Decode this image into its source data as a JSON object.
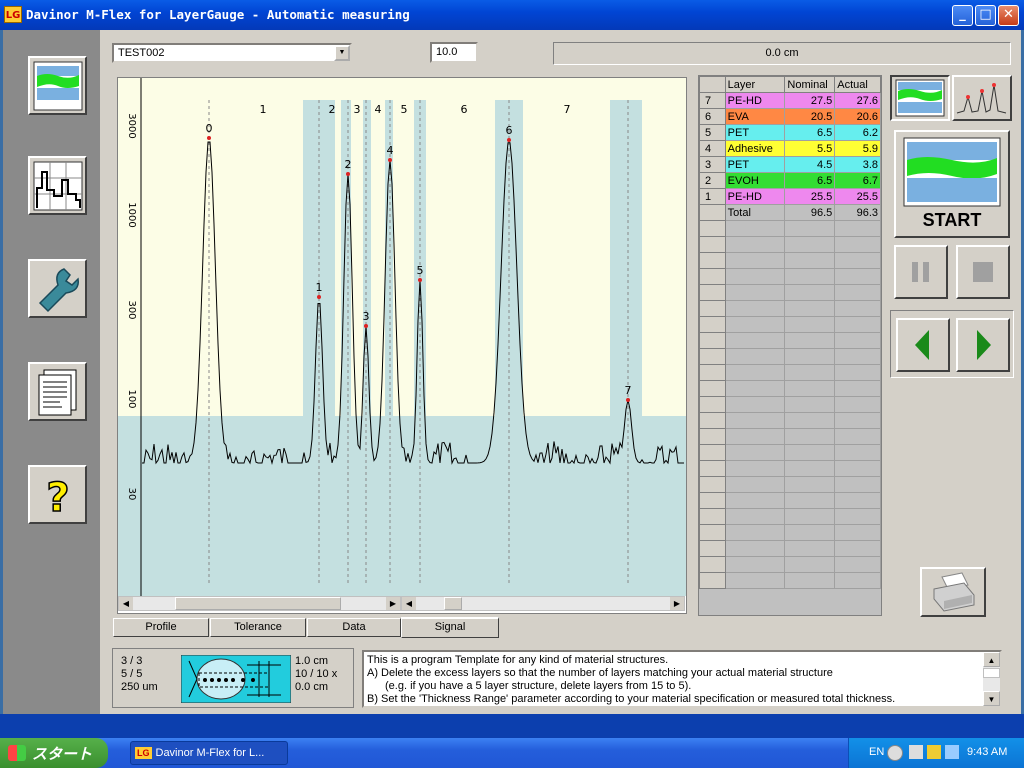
{
  "window": {
    "title": "Davinor M-Flex for LayerGauge - Automatic measuring",
    "logo": "LG"
  },
  "toolbar": {
    "combo_value": "TEST002",
    "range_value": "10.0",
    "position_readout": "0.0 cm"
  },
  "nav": [
    "profile-view-icon",
    "statistics-icon",
    "settings-wrench-icon",
    "report-icon",
    "help-icon"
  ],
  "chart_data": {
    "type": "line",
    "yaxis": {
      "scale": "log",
      "tick_labels": [
        "3000",
        "1000",
        "300",
        "100",
        "30"
      ]
    },
    "layer_labels": [
      "1",
      "2",
      "3",
      "4",
      "5",
      "6",
      "7"
    ],
    "peaks": [
      {
        "label": "0"
      },
      {
        "label": "1"
      },
      {
        "label": "2"
      },
      {
        "label": "3"
      },
      {
        "label": "4"
      },
      {
        "label": "5"
      },
      {
        "label": "6"
      },
      {
        "label": "7"
      }
    ]
  },
  "tabs": [
    "Profile",
    "Tolerance",
    "Data",
    "Signal"
  ],
  "active_tab": "Signal",
  "layer_table": {
    "headers": [
      "Layer",
      "Nominal",
      "Actual"
    ],
    "rows": [
      {
        "index": "7",
        "layer": "PE-HD",
        "nominal": "27.5",
        "actual": "27.6",
        "color": "#ee88ee"
      },
      {
        "index": "6",
        "layer": "EVA",
        "nominal": "20.5",
        "actual": "20.6",
        "color": "#ff8844"
      },
      {
        "index": "5",
        "layer": "PET",
        "nominal": "6.5",
        "actual": "6.2",
        "color": "#66eeee"
      },
      {
        "index": "4",
        "layer": "Adhesive",
        "nominal": "5.5",
        "actual": "5.9",
        "color": "#ffff33"
      },
      {
        "index": "3",
        "layer": "PET",
        "nominal": "4.5",
        "actual": "3.8",
        "color": "#66eeee"
      },
      {
        "index": "2",
        "layer": "EVOH",
        "nominal": "6.5",
        "actual": "6.7",
        "color": "#33dd33"
      },
      {
        "index": "1",
        "layer": "PE-HD",
        "nominal": "25.5",
        "actual": "25.5",
        "color": "#ee88ee"
      }
    ],
    "total": {
      "label": "Total",
      "nominal": "96.5",
      "actual": "96.3"
    }
  },
  "controls": {
    "start_label": "START"
  },
  "status": {
    "lines_left": [
      "3 / 3",
      "5 / 5",
      "250 um"
    ],
    "lines_right": [
      "1.0 cm",
      "10 / 10 x",
      "0.0 cm"
    ]
  },
  "notes": [
    "This is a program Template for any kind of material structures.",
    "A) Delete the excess layers so that the number of layers matching your actual material structure",
    "(e.g. if you have a 5 layer structure, delete layers from 15 to 5).",
    "B) Set the 'Thickness Range' parameter according to your material specification or measured total thickness."
  ],
  "taskbar": {
    "start_label": "スタート",
    "app_item": "Davinor M-Flex for L...",
    "lang": "EN",
    "clock": "9:43 AM"
  }
}
